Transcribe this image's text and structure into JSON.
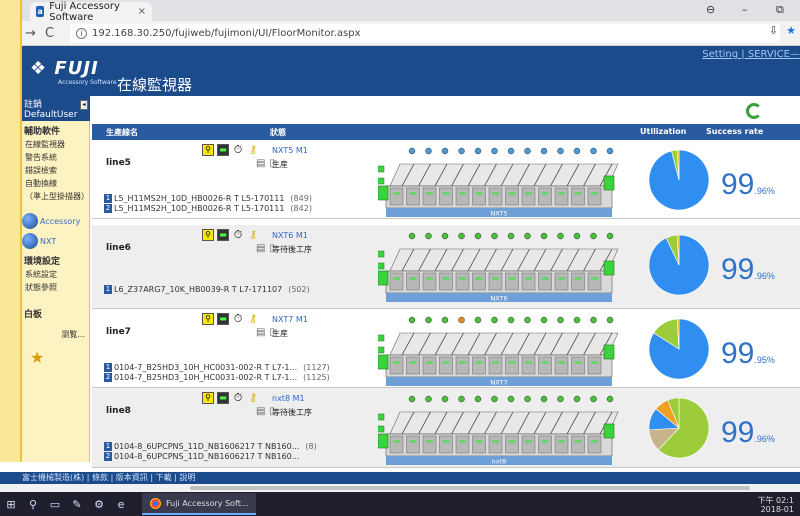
{
  "browser": {
    "tab_title": "Fuji Accessory Software",
    "tab_close": "×",
    "url": "192.168.30.250/fujiweb/fujimoni/UI/FloorMonitor.aspx",
    "back": "←",
    "forward": "→",
    "reload": "C",
    "account_glyph": "⊖",
    "minimize_glyph": "–",
    "restore_glyph": "⧉"
  },
  "app": {
    "logo": "FUJI",
    "logo_sub": "Accessory Software",
    "title": "在線監視器",
    "top_links": "Setting | SERVICE—"
  },
  "sidebar": {
    "user_label": "註銷",
    "user_name": "DefaultUser",
    "section1_title": "輔助軟件",
    "section1_items": [
      "在線監視器",
      "警告系統",
      "錯誤檢索",
      "自動換線",
      "（準上型掛描器）"
    ],
    "accessory": "Accessory",
    "nxt": "NXT",
    "section2_title": "環境設定",
    "section2_items": [
      "系統設定",
      "狀態參照"
    ],
    "section3_title": "白板",
    "browse": "瀏覧..."
  },
  "table": {
    "col_line": "生產線名",
    "col_status": "狀態",
    "col_util": "Utilization",
    "col_success": "Success rate"
  },
  "rows": [
    {
      "line": "line5",
      "machine": "NXT5 M1",
      "status": "生産",
      "base_label": "NXT5",
      "programs": [
        {
          "idx": "1",
          "name": "L5_H11MS2H_10D_HB0026-R T L5-170111",
          "count": "(849)"
        },
        {
          "idx": "2",
          "name": "L5_H11MS2H_10D_HB0026-R T L5-170111",
          "count": "(842)"
        }
      ],
      "rate_big": "99",
      "rate_small": ".96%",
      "pie": [
        {
          "value": 0.96,
          "color": "#2f8ef0"
        },
        {
          "value": 0.03,
          "color": "#9ccc3c"
        },
        {
          "value": 0.01,
          "color": "#e0a800"
        }
      ]
    },
    {
      "line": "line6",
      "machine": "NXT6 M1",
      "status": "等待後工序",
      "base_label": "NXT6",
      "programs": [
        {
          "idx": "1",
          "name": "L6_Z37ARG7_10K_HB0039-R T L7-171107",
          "count": "(502)"
        }
      ],
      "rate_big": "99",
      "rate_small": ".96%",
      "pie": [
        {
          "value": 0.93,
          "color": "#2f8ef0"
        },
        {
          "value": 0.06,
          "color": "#9ccc3c"
        },
        {
          "value": 0.01,
          "color": "#e0a800"
        }
      ]
    },
    {
      "line": "line7",
      "machine": "NXT7 M1",
      "status": "生産",
      "base_label": "NXT7",
      "programs": [
        {
          "idx": "1",
          "name": "0104-7_B25HD3_10H_HC0031-002-R T L7-1...",
          "count": "(1127)"
        },
        {
          "idx": "2",
          "name": "0104-7_B25HD3_10H_HC0031-002-R T L7-1...",
          "count": "(1125)"
        }
      ],
      "rate_big": "99",
      "rate_small": ".95%",
      "pie": [
        {
          "value": 0.84,
          "color": "#2f8ef0"
        },
        {
          "value": 0.15,
          "color": "#9ccc3c"
        },
        {
          "value": 0.01,
          "color": "#e0a800"
        }
      ]
    },
    {
      "line": "line8",
      "machine": "nxt8 M1",
      "status": "等待後工序",
      "base_label": "nxt8",
      "programs": [
        {
          "idx": "1",
          "name": "0104-8_6UPCPNS_11D_NB1606217 T NB160...",
          "count": "(8)"
        },
        {
          "idx": "2",
          "name": "0104-8_6UPCPNS_11D_NB1606217 T NB160...",
          "count": ""
        }
      ],
      "rate_big": "99",
      "rate_small": ".96%",
      "pie": [
        {
          "value": 0.62,
          "color": "#9ccc3c"
        },
        {
          "value": 0.12,
          "color": "#c8b48c"
        },
        {
          "value": 0.12,
          "color": "#2f8ef0"
        },
        {
          "value": 0.08,
          "color": "#f0a020"
        },
        {
          "value": 0.06,
          "color": "#9ccc3c"
        }
      ]
    }
  ],
  "footer": "富士機械製造(株) | 條款 | 版本資訊 | 下載 | 說明",
  "taskbar": {
    "app_label": "Fuji Accessory Soft...",
    "time": "下午 02:1",
    "date": "2018-01"
  }
}
